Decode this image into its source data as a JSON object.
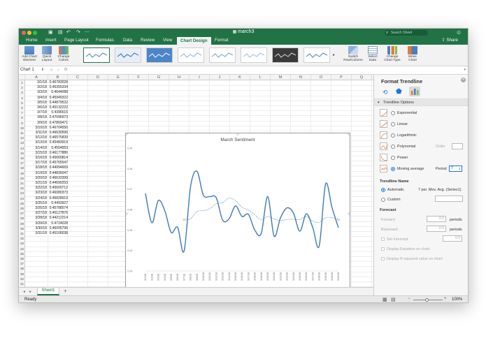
{
  "window": {
    "title": "march3",
    "search_placeholder": "Search Sheet",
    "share": "Share"
  },
  "tabs": [
    "Home",
    "Insert",
    "Page Layout",
    "Formulas",
    "Data",
    "Review",
    "View",
    "Chart Design",
    "Format"
  ],
  "ribbon": {
    "add_chart_element": "Add Chart Element",
    "quick_layout": "Quick Layout",
    "change_colors": "Change Colors",
    "switch_row_col": "Switch Row/Column",
    "select_data": "Select Data",
    "change_chart_type": "Change Chart Type",
    "move_chart": "Move Chart"
  },
  "formula_bar": {
    "name_box": "Chart 1",
    "fx": "fx"
  },
  "columns": [
    "A",
    "B",
    "C",
    "D",
    "E",
    "F",
    "G",
    "H",
    "I",
    "J",
    "K",
    "L",
    "M",
    "N",
    "O",
    "P",
    "Q"
  ],
  "rows_data": [
    [
      "3/1/18",
      "0.46783028"
    ],
    [
      "3/2/18",
      "0.45355334"
    ],
    [
      "3/3/18",
      "0.4644088"
    ],
    [
      "3/4/18",
      "0.45949322"
    ],
    [
      "3/5/18",
      "0.44879532"
    ],
    [
      "3/6/18",
      "0.45132222"
    ],
    [
      "3/7/18",
      "0.4396516"
    ],
    [
      "3/8/18",
      "0.47096973"
    ],
    [
      "3/9/18",
      "0.47869471"
    ],
    [
      "3/10/18",
      "0.46704556"
    ],
    [
      "3/11/18",
      "0.46630596"
    ],
    [
      "3/12/18",
      "0.46575839"
    ],
    [
      "3/13/18",
      "0.45483919"
    ],
    [
      "3/14/18",
      "0.4554553"
    ],
    [
      "3/15/18",
      "0.46177886"
    ],
    [
      "3/16/18",
      "0.45660814"
    ],
    [
      "3/17/18",
      "0.45765547"
    ],
    [
      "3/18/18",
      "0.44994669"
    ],
    [
      "3/19/18",
      "0.44836047"
    ],
    [
      "3/20/18",
      "0.46633399"
    ],
    [
      "3/21/18",
      "0.44699253"
    ],
    [
      "3/22/18",
      "0.45600712"
    ],
    [
      "3/23/18",
      "0.46080373"
    ],
    [
      "3/24/18",
      "0.45828919"
    ],
    [
      "3/25/18",
      "0.4493927"
    ],
    [
      "3/26/18",
      "0.45788574"
    ],
    [
      "3/27/18",
      "0.45127876"
    ],
    [
      "3/28/18",
      "0.44212214"
    ],
    [
      "3/29/18",
      "0.4724028"
    ],
    [
      "3/30/18",
      "0.46095796"
    ],
    [
      "3/31/18",
      "0.45106038"
    ]
  ],
  "sheet_tab": "Sheet1",
  "status": {
    "ready": "Ready",
    "zoom": "100%"
  },
  "pane": {
    "title": "Format Trendline",
    "section": "Trendline Options",
    "options": [
      "Exponential",
      "Linear",
      "Logarithmic",
      "Polynomial",
      "Power",
      "Moving average"
    ],
    "order_label": "Order",
    "period_label": "Period",
    "period_value": "7",
    "name_header": "Trendline Name",
    "automatic": "Automatic",
    "automatic_value": "7 per. Mov. Avg. (Series1)",
    "custom": "Custom",
    "forecast_header": "Forecast",
    "forward": "Forward",
    "backward": "Backward",
    "forward_val": "0.0",
    "backward_val": "0.0",
    "periods": "periods",
    "set_intercept": "Set Intercept",
    "intercept_val": "0.0",
    "display_eq": "Display Equation on chart",
    "display_r2": "Display R-squared value on chart"
  },
  "chart_data": {
    "type": "line",
    "title": "March Sentiment",
    "categories": [
      "3/1/18",
      "3/2/18",
      "3/3/18",
      "3/4/18",
      "3/5/18",
      "3/6/18",
      "3/7/18",
      "3/8/18",
      "3/9/18",
      "3/10/18",
      "3/11/18",
      "3/12/18",
      "3/13/18",
      "3/14/18",
      "3/15/18",
      "3/16/18",
      "3/17/18",
      "3/18/18",
      "3/19/18",
      "3/20/18",
      "3/21/18",
      "3/22/18",
      "3/23/18",
      "3/24/18",
      "3/25/18",
      "3/26/18",
      "3/27/18",
      "3/28/18",
      "3/29/18",
      "3/30/18",
      "3/31/18"
    ],
    "values": [
      0.46783028,
      0.45355334,
      0.4644088,
      0.45949322,
      0.44879532,
      0.45132222,
      0.4396516,
      0.47096973,
      0.47869471,
      0.46704556,
      0.46630596,
      0.46575839,
      0.45483919,
      0.4554553,
      0.46177886,
      0.45660814,
      0.45765547,
      0.44994669,
      0.44836047,
      0.46633399,
      0.44699253,
      0.45600712,
      0.46080373,
      0.45828919,
      0.4493927,
      0.45788574,
      0.45127876,
      0.44212214,
      0.4724028,
      0.46095796,
      0.45106038
    ],
    "trendline": {
      "type": "moving average",
      "period": 7
    },
    "ylim": [
      0.43,
      0.49
    ],
    "yticks": [
      "0.49",
      "0.48",
      "0.47",
      "0.46",
      "0.45",
      "0.44",
      "0.43"
    ],
    "series_color": "#3d7ab8"
  }
}
